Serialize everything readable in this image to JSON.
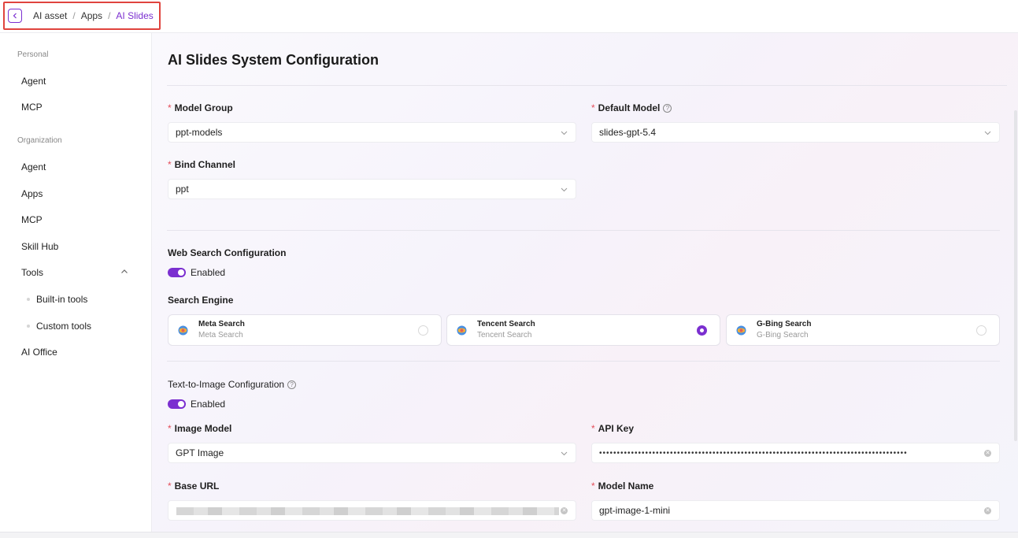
{
  "breadcrumb": {
    "items": [
      "AI asset",
      "Apps",
      "AI Slides"
    ],
    "separator": "/"
  },
  "sidebar": {
    "personal_label": "Personal",
    "personal_items": [
      "Agent",
      "MCP"
    ],
    "organization_label": "Organization",
    "org_items": [
      "Agent",
      "Apps",
      "MCP",
      "Skill Hub",
      "Tools"
    ],
    "tools_children": [
      "Built-in tools",
      "Custom tools"
    ],
    "last_item": "AI Office"
  },
  "page": {
    "title": "AI Slides System Configuration"
  },
  "form": {
    "model_group": {
      "label": "Model Group",
      "value": "ppt-models"
    },
    "default_model": {
      "label": "Default Model",
      "value": "slides-gpt-5.4"
    },
    "bind_channel": {
      "label": "Bind Channel",
      "value": "ppt"
    },
    "web_search": {
      "label": "Web Search Configuration",
      "toggle_label": "Enabled",
      "enabled": true
    },
    "search_engine": {
      "label": "Search Engine",
      "options": [
        {
          "name": "Meta Search",
          "sub": "Meta Search",
          "selected": false
        },
        {
          "name": "Tencent Search",
          "sub": "Tencent Search",
          "selected": true
        },
        {
          "name": "G-Bing Search",
          "sub": "G-Bing Search",
          "selected": false
        }
      ]
    },
    "text_to_image": {
      "label": "Text-to-Image Configuration",
      "toggle_label": "Enabled",
      "enabled": true
    },
    "image_model": {
      "label": "Image Model",
      "value": "GPT Image"
    },
    "api_key": {
      "label": "API Key",
      "value": "•••••••••••••••••••••••••••••••••••••••••••••••••••••••••••••••••••••••••••••••••••••••"
    },
    "base_url": {
      "label": "Base URL"
    },
    "model_name": {
      "label": "Model Name",
      "value": "gpt-image-1-mini"
    }
  },
  "icons": {
    "back": "chevron-left-icon",
    "select": "chevron-down-icon",
    "help": "question-circle-icon",
    "engine": "globe-icon",
    "clear": "clear-circle-icon"
  },
  "colors": {
    "accent": "#7b2fd0",
    "required": "#e34d59",
    "highlight_border": "#e0443e"
  }
}
